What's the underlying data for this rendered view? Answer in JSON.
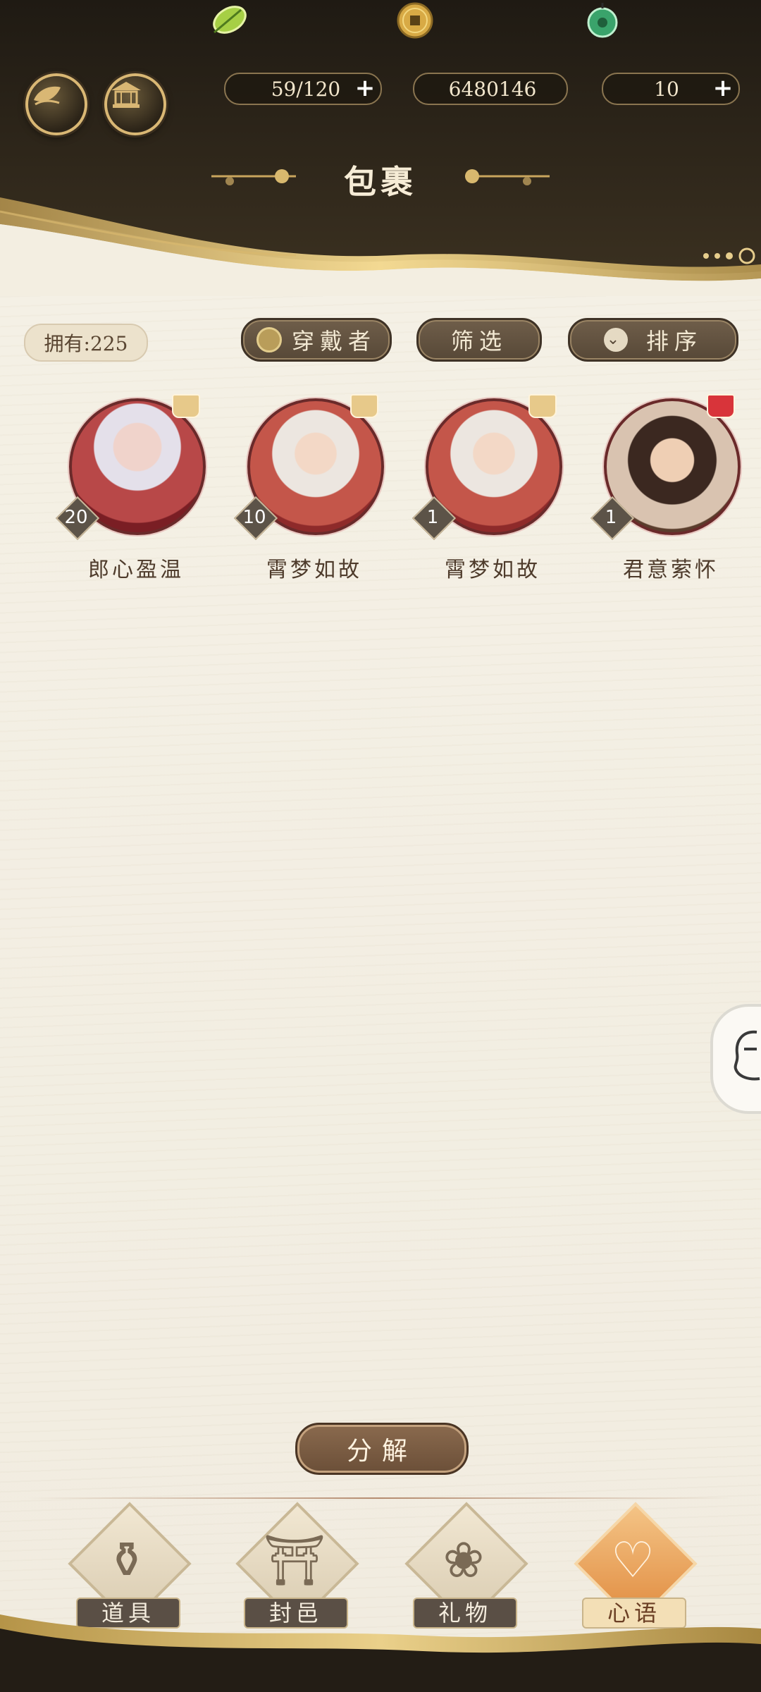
{
  "header": {
    "title": "包裹",
    "resources": {
      "stamina": {
        "value": "59/120",
        "icon": "leaf-icon"
      },
      "coins": {
        "value": "6480146",
        "icon": "coin-icon"
      },
      "jade": {
        "value": "10",
        "icon": "jade-pendant-icon"
      }
    }
  },
  "toolbar": {
    "owned": "拥有:225",
    "wearer": "穿戴者",
    "filter": "筛选",
    "sort": "排序"
  },
  "cards": [
    {
      "name": "郎心盈温",
      "count": "20"
    },
    {
      "name": "霄梦如故",
      "count": "10"
    },
    {
      "name": "霄梦如故",
      "count": "1"
    },
    {
      "name": "君意萦怀",
      "count": "1"
    }
  ],
  "actions": {
    "decompose": "分解"
  },
  "tabs": [
    {
      "label": "道具",
      "icon": "jar-icon",
      "active": false
    },
    {
      "label": "封邑",
      "icon": "palace-icon",
      "active": false
    },
    {
      "label": "礼物",
      "icon": "fan-icon",
      "active": false
    },
    {
      "label": "心语",
      "icon": "heart-flower-icon",
      "active": true
    }
  ],
  "colors": {
    "header_dark": "#2b241b",
    "gold": "#d9b774",
    "paper": "#f3eee1",
    "active_tab": "#e08a3e"
  }
}
